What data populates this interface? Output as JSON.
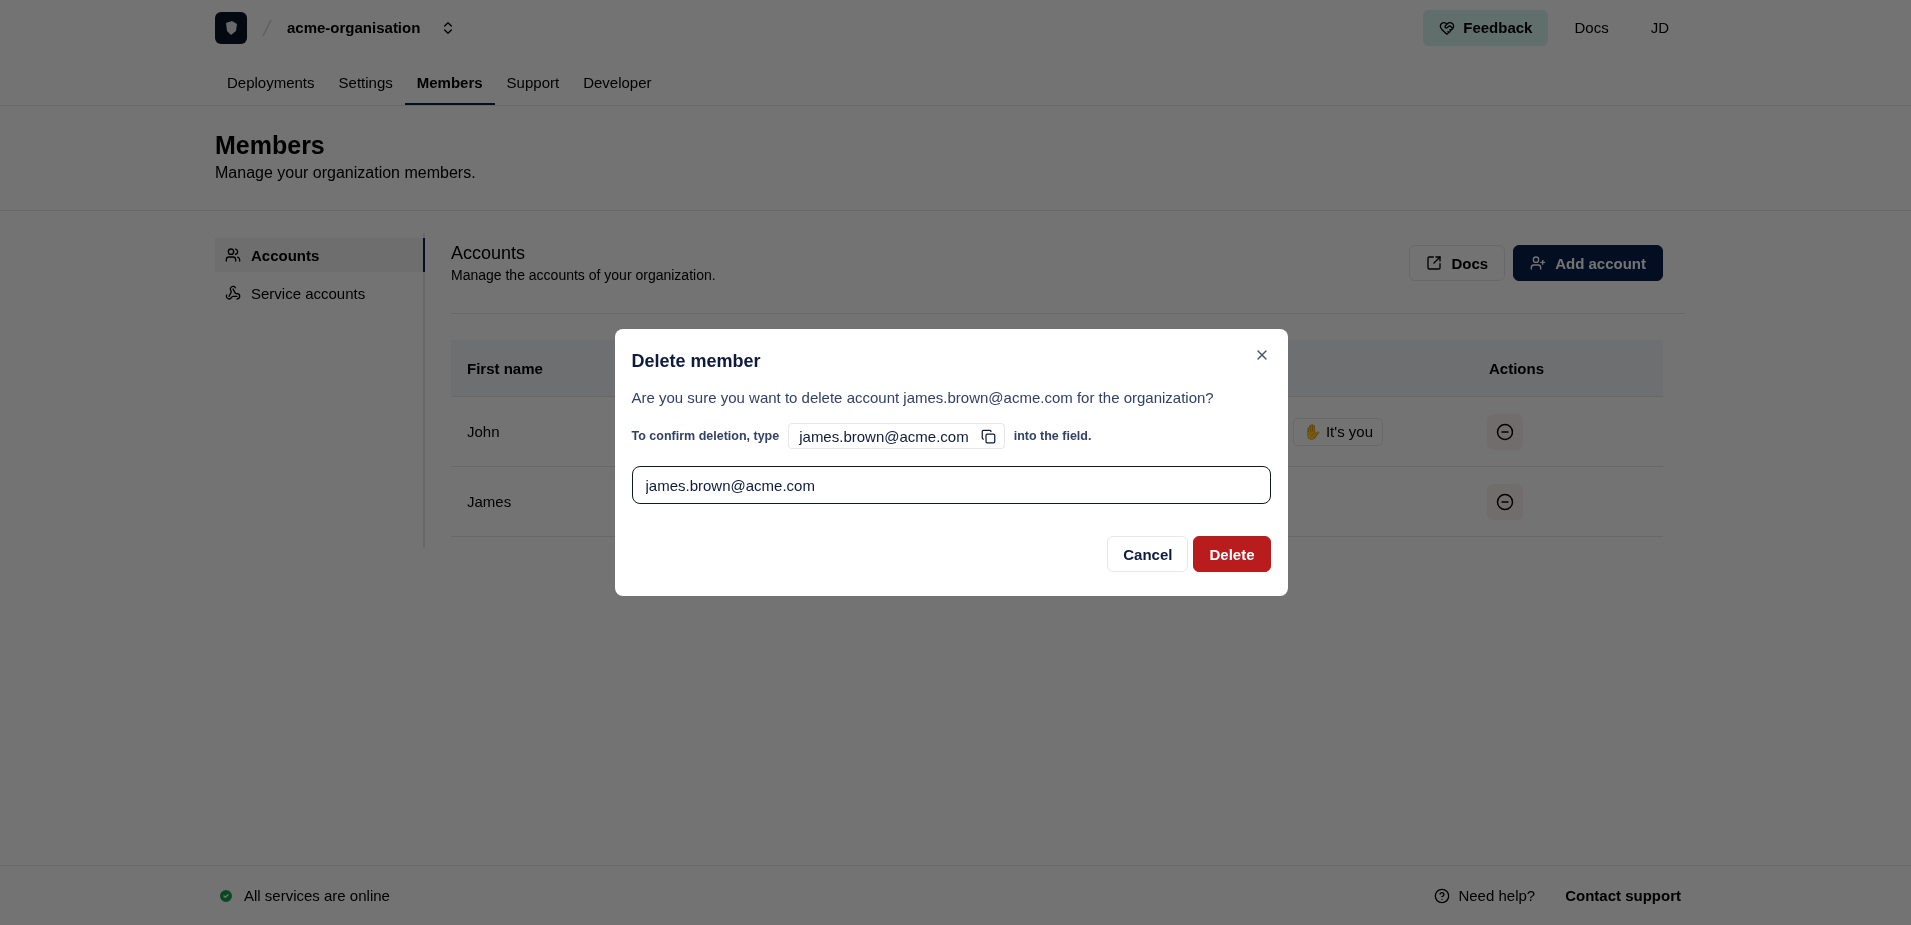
{
  "header": {
    "org": "acme-organisation",
    "actions": [
      {
        "kind": "feedback",
        "label": "Feedback"
      },
      {
        "kind": "link",
        "label": "Docs"
      },
      {
        "kind": "avatar",
        "label": "JD"
      }
    ]
  },
  "tabs": [
    {
      "label": "Deployments",
      "selected": false
    },
    {
      "label": "Settings",
      "selected": false
    },
    {
      "label": "Members",
      "selected": true
    },
    {
      "label": "Support",
      "selected": false
    },
    {
      "label": "Developer",
      "selected": false
    }
  ],
  "page": {
    "title": "Members",
    "subtitle": "Manage your organization members."
  },
  "sidebar": {
    "items": [
      {
        "kind": "users",
        "label": "Accounts",
        "selected": true
      },
      {
        "kind": "service",
        "label": "Service accounts",
        "selected": false
      }
    ]
  },
  "section": {
    "title": "Accounts",
    "subtitle": "Manage the accounts of your organization.",
    "buttons": [
      {
        "kind": "docs",
        "label": "Docs"
      },
      {
        "kind": "add",
        "label": "Add account"
      }
    ]
  },
  "table": {
    "columns": {
      "first": "First name",
      "last": "Actions"
    },
    "rows": [
      {
        "first_name": "John",
        "badge": "✋ It's you"
      },
      {
        "first_name": "James"
      }
    ]
  },
  "dialog": {
    "title": "Delete member",
    "message": "Are you sure you want to delete account james.brown@acme.com for the organization?",
    "confirm_prefix": "To confirm deletion, type",
    "confirm_value": "james.brown@acme.com",
    "confirm_suffix": "into the field.",
    "input_value": "james.brown@acme.com",
    "buttons": [
      {
        "kind": "cancel",
        "label": "Cancel"
      },
      {
        "kind": "danger",
        "label": "Delete"
      }
    ]
  },
  "footer": {
    "status": {
      "text": "All services are online",
      "ok": true
    },
    "help": "Need help?",
    "contact": "Contact support"
  }
}
